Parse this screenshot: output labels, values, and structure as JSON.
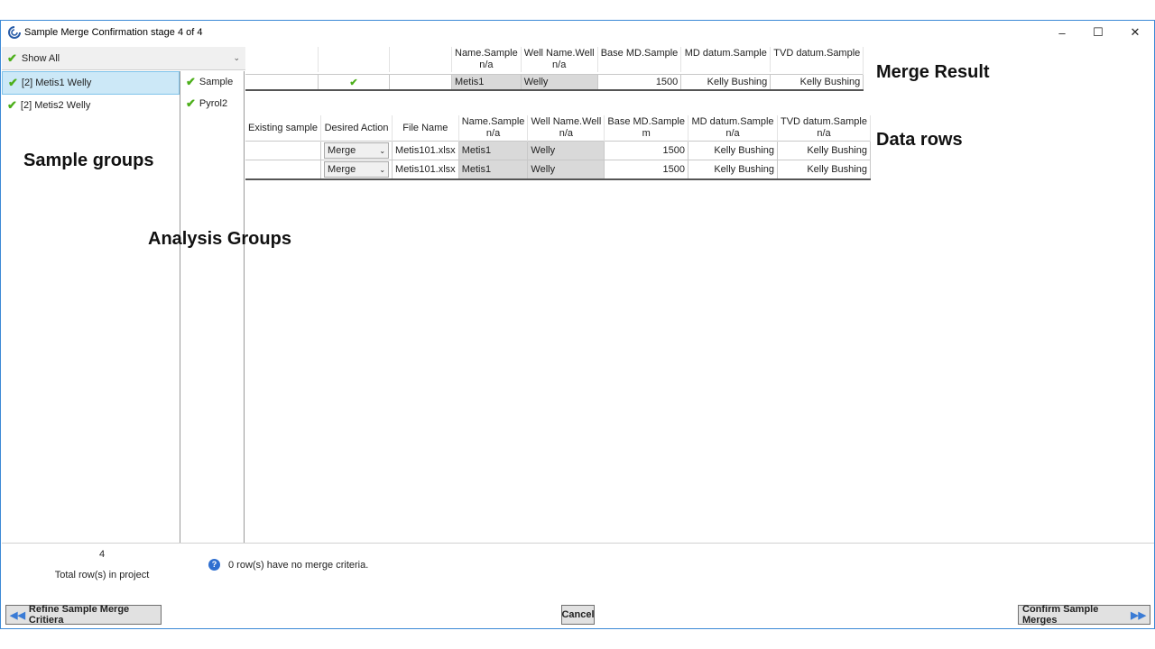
{
  "window": {
    "title": "Sample Merge Confirmation stage 4 of 4",
    "minimize": "–",
    "maximize": "☐",
    "close": "✕"
  },
  "show_all": {
    "label": "Show All"
  },
  "sample_groups": [
    {
      "label": "[2] Metis1 Welly",
      "selected": true
    },
    {
      "label": "[2] Metis2 Welly",
      "selected": false
    }
  ],
  "analysis_groups": [
    {
      "label": "Sample"
    },
    {
      "label": "Pyrol2"
    }
  ],
  "merge_result": {
    "headers": [
      {
        "line1": "",
        "line2": ""
      },
      {
        "line1": "",
        "line2": ""
      },
      {
        "line1": "",
        "line2": ""
      },
      {
        "line1": "Name.Sample",
        "line2": "n/a"
      },
      {
        "line1": "Well Name.Well",
        "line2": "n/a"
      },
      {
        "line1": "Base MD.Sample",
        "line2": ""
      },
      {
        "line1": "MD datum.Sample",
        "line2": ""
      },
      {
        "line1": "TVD datum.Sample",
        "line2": ""
      }
    ],
    "row": {
      "existing": "",
      "action_check": "✔",
      "file_name": "",
      "name": "Metis1",
      "well_name": "Welly",
      "base_md": "1500",
      "md_datum": "Kelly Bushing",
      "tvd_datum": "Kelly Bushing"
    }
  },
  "data_rows": {
    "headers": [
      {
        "line1": "Existing sample",
        "line2": ""
      },
      {
        "line1": "Desired Action",
        "line2": ""
      },
      {
        "line1": "File Name",
        "line2": ""
      },
      {
        "line1": "Name.Sample",
        "line2": "n/a"
      },
      {
        "line1": "Well Name.Well",
        "line2": "n/a"
      },
      {
        "line1": "Base MD.Sample",
        "line2": "m"
      },
      {
        "line1": "MD datum.Sample",
        "line2": "n/a"
      },
      {
        "line1": "TVD datum.Sample",
        "line2": "n/a"
      }
    ],
    "rows": [
      {
        "existing": "",
        "action": "Merge",
        "file_name": "Metis101.xlsx",
        "name": "Metis1",
        "well_name": "Welly",
        "base_md": "1500",
        "md_datum": "Kelly Bushing",
        "tvd_datum": "Kelly Bushing"
      },
      {
        "existing": "",
        "action": "Merge",
        "file_name": "Metis101.xlsx",
        "name": "Metis1",
        "well_name": "Welly",
        "base_md": "1500",
        "md_datum": "Kelly Bushing",
        "tvd_datum": "Kelly Bushing"
      }
    ]
  },
  "annotations": {
    "merge_result": "Merge Result",
    "data_rows": "Data rows",
    "sample_groups": "Sample groups",
    "analysis_groups": "Analysis Groups"
  },
  "footer": {
    "total_count": "4",
    "total_label": "Total row(s) in project",
    "info_text": "0 row(s) have no merge criteria.",
    "refine_button": "Refine Sample Merge Critiera",
    "cancel_button": "Cancel",
    "confirm_button": "Confirm Sample Merges"
  },
  "colors": {
    "check_green": "#4caf1a",
    "selection_blue": "#cce8f7",
    "window_border": "#3c8ad6"
  }
}
